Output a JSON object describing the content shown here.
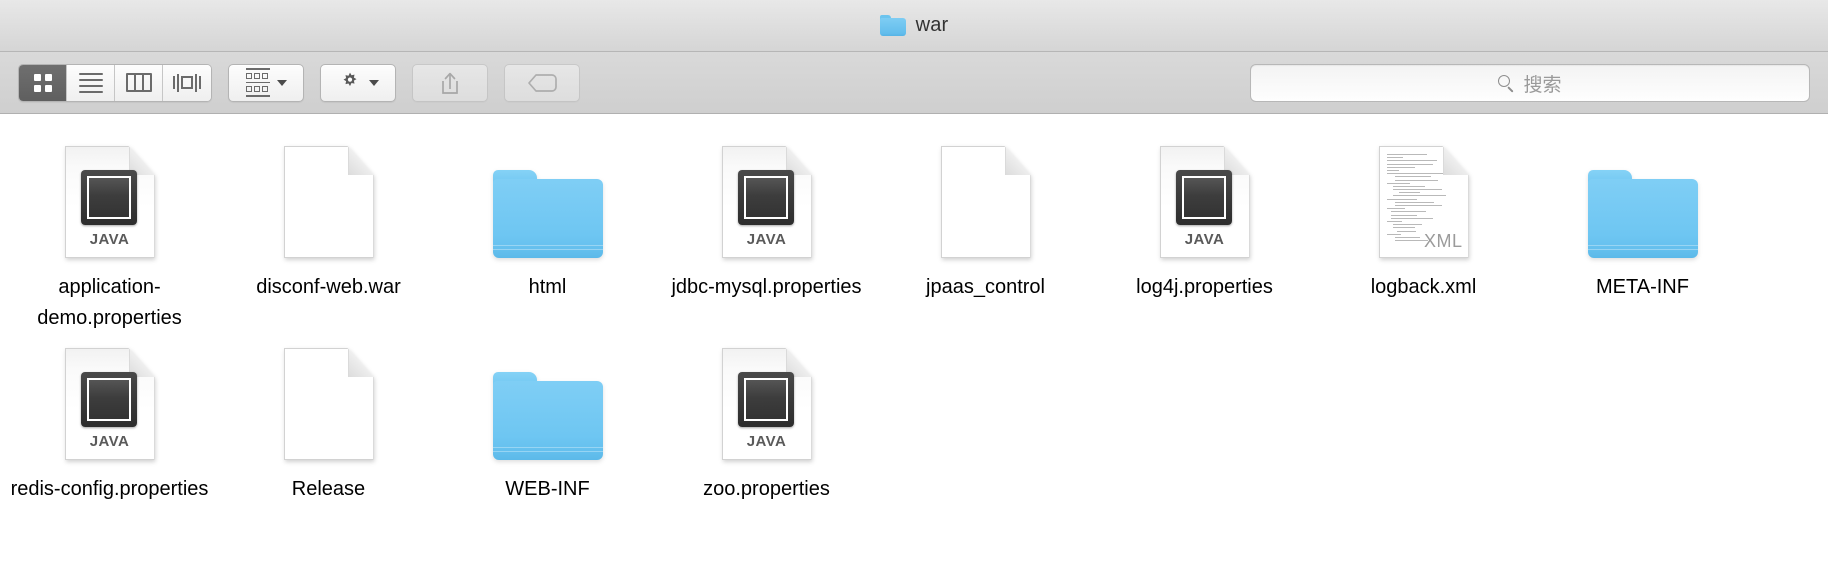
{
  "window": {
    "title": "war",
    "title_icon": "folder-icon"
  },
  "toolbar": {
    "view_modes": [
      {
        "name": "icon-view",
        "icon": "grid-icon",
        "active": true
      },
      {
        "name": "list-view",
        "icon": "list-icon",
        "active": false
      },
      {
        "name": "column-view",
        "icon": "columns-icon",
        "active": false
      },
      {
        "name": "coverflow-view",
        "icon": "coverflow-icon",
        "active": false
      }
    ],
    "arrange_button": {
      "icon": "arrange-icon",
      "chevron": "chevron-down-icon"
    },
    "action_button": {
      "icon": "gear-icon",
      "chevron": "chevron-down-icon"
    },
    "share_button": {
      "icon": "share-icon"
    },
    "tag_button": {
      "icon": "tag-icon"
    },
    "search": {
      "placeholder": "搜索",
      "value": "",
      "icon": "search-icon"
    }
  },
  "files": {
    "rows": [
      [
        {
          "name": "application-demo.properties",
          "type": "java",
          "badge": "JAVA"
        },
        {
          "name": "disconf-web.war",
          "type": "doc",
          "badge": ""
        },
        {
          "name": "html",
          "type": "folder",
          "badge": ""
        },
        {
          "name": "jdbc-mysql.properties",
          "type": "java",
          "badge": "JAVA"
        },
        {
          "name": "jpaas_control",
          "type": "doc",
          "badge": ""
        },
        {
          "name": "log4j.properties",
          "type": "java",
          "badge": "JAVA"
        },
        {
          "name": "logback.xml",
          "type": "xml",
          "badge": "XML"
        },
        {
          "name": "META-INF",
          "type": "folder",
          "badge": ""
        }
      ],
      [
        {
          "name": "redis-config.properties",
          "type": "java",
          "badge": "JAVA"
        },
        {
          "name": "Release",
          "type": "doc",
          "badge": ""
        },
        {
          "name": "WEB-INF",
          "type": "folder",
          "badge": ""
        },
        {
          "name": "zoo.properties",
          "type": "java",
          "badge": "JAVA"
        }
      ]
    ]
  },
  "colors": {
    "folder_blue": "#6ec6f2",
    "titlebar": "#dcdcdc",
    "toolbar": "#d4d4d4",
    "selected_segment": "#6a6a6a",
    "label_text": "#000000",
    "placeholder_text": "#9a9a9a"
  }
}
